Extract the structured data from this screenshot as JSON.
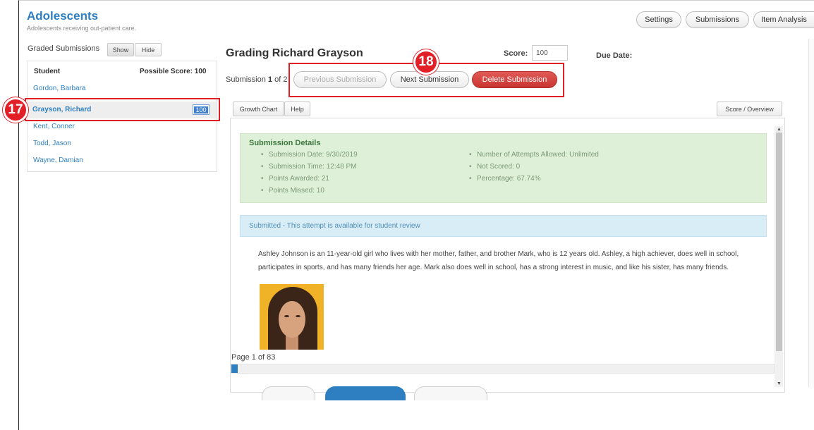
{
  "course": {
    "title": "Adolescents",
    "subtitle": "Adolescents receiving out-patient care."
  },
  "top_nav": {
    "settings": "Settings",
    "submissions": "Submissions",
    "item_analysis": "Item Analysis"
  },
  "sidebar": {
    "graded_label": "Graded Submissions",
    "show": "Show",
    "hide": "Hide",
    "header_student": "Student",
    "header_score": "Possible Score: 100",
    "students": [
      {
        "name": "Gordon, Barbara"
      },
      {
        "name": "Grayson, Richard",
        "score": "100",
        "selected": true
      },
      {
        "name": "Kent, Conner"
      },
      {
        "name": "Todd, Jason"
      },
      {
        "name": "Wayne, Damian"
      }
    ]
  },
  "callouts": {
    "a": "17",
    "b": "18"
  },
  "grading": {
    "title": "Grading Richard Grayson",
    "score_label": "Score:",
    "score_value": "100",
    "due_label": "Due Date:",
    "submission_prefix": "Submission ",
    "submission_current": "1",
    "submission_suffix": " of 2",
    "prev_button": "Previous Submission",
    "next_button": "Next Submission",
    "delete_button": "Delete Submission",
    "growth_chart": "Growth Chart",
    "help": "Help",
    "score_overview": "Score / Overview"
  },
  "details": {
    "title": "Submission Details",
    "left": [
      "Submission Date: 9/30/2019",
      "Submission Time: 12:48 PM",
      "Points Awarded: 21",
      "Points Missed: 10"
    ],
    "right": [
      "Number of Attempts Allowed: Unlimited",
      "Not Scored: 0",
      "Percentage: 67.74%"
    ]
  },
  "status": {
    "text": "Submitted - This attempt is available for student review"
  },
  "passage": {
    "text": "Ashley Johnson is an 11-year-old girl who lives with her mother, father, and brother Mark, who is 12 years old. Ashley, a high achiever, does well in school, participates in sports, and has many friends her age. Mark also does well in school, has a strong interest in music, and like his sister, has many friends."
  },
  "pagination": {
    "label": "Page 1 of 83",
    "current": 1,
    "total": 83
  },
  "colors": {
    "accent": "#2e7fc1",
    "danger": "#d9534f",
    "success_bg": "#dff0d8",
    "info_bg": "#d9edf7",
    "callout": "#e21e26"
  }
}
